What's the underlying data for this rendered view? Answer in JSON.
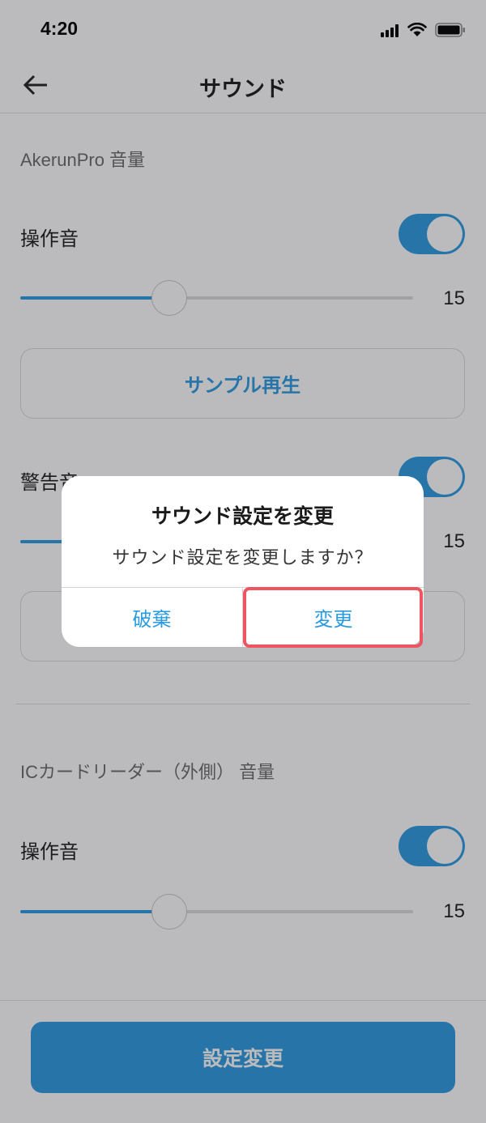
{
  "colors": {
    "accent": "#2b9be0",
    "highlight": "#ef5560"
  },
  "status_bar": {
    "time": "4:20",
    "icons": [
      "cellular-signal-icon",
      "wifi-icon",
      "battery-icon"
    ]
  },
  "header": {
    "back_icon": "back-arrow-icon",
    "title": "サウンド"
  },
  "akerun_pro": {
    "section_label": "AkerunPro 音量",
    "operation_sound": {
      "label": "操作音",
      "enabled": true,
      "volume": "15",
      "level": 0.38
    },
    "sample_button": "サンプル再生",
    "warning_sound": {
      "label": "警告音",
      "enabled": true,
      "volume": "15",
      "level": 0.38
    }
  },
  "ic_card_reader": {
    "section_label": "ICカードリーダー（外側） 音量",
    "operation_sound": {
      "label": "操作音",
      "enabled": true,
      "volume": "15",
      "level": 0.38
    }
  },
  "footer": {
    "submit_label": "設定変更"
  },
  "dialog": {
    "title": "サウンド設定を変更",
    "message": "サウンド設定を変更しますか？",
    "discard_label": "破棄",
    "confirm_label": "変更"
  }
}
